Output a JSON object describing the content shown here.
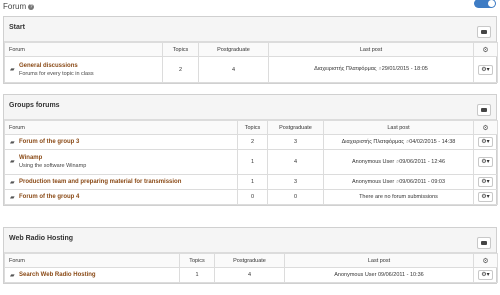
{
  "header": {
    "title": "Forum",
    "help_icon": "question-circle-icon"
  },
  "columns": {
    "forum": "Forum",
    "topics": "Topics",
    "postgraduate": "Postgraduate",
    "last_post": "Last post"
  },
  "categories": [
    {
      "title": "Start",
      "rows": [
        {
          "name": "General discussions",
          "description": "Forums for every topic in class",
          "topics": "2",
          "postgraduate": "4",
          "last_post_author": "Διαχειριστής Πλατφόρμας",
          "last_post_date": "29/01/2015 - 18:05"
        }
      ]
    },
    {
      "title": "Groups forums",
      "rows": [
        {
          "name": "Forum of the group 3",
          "description": "",
          "topics": "2",
          "postgraduate": "3",
          "last_post_author": "Διαχειριστής Πλατφόρμας",
          "last_post_date": "04/02/2015 - 14:38"
        },
        {
          "name": "Winamp",
          "description": "Using the software Winamp",
          "topics": "1",
          "postgraduate": "4",
          "last_post_author": "Anonymous User",
          "last_post_date": "09/06/2011 - 12:46"
        },
        {
          "name": "Production team and preparing material for transmission",
          "description": "",
          "topics": "1",
          "postgraduate": "3",
          "last_post_author": "Anonymous User",
          "last_post_date": "09/06/2011 - 09:03"
        },
        {
          "name": "Forum of the group 4",
          "description": "",
          "topics": "0",
          "postgraduate": "0",
          "last_post_text": "There are no forum submissions"
        }
      ]
    },
    {
      "title": "Web Radio Hosting",
      "rows": [
        {
          "name": "Search Web Radio Hosting",
          "description": "",
          "topics": "1",
          "postgraduate": "4",
          "last_post_author": "Anonymous User",
          "last_post_date": "09/06/2011 - 10:36"
        }
      ]
    }
  ],
  "icons": {
    "row": "chat-icon",
    "row_action": "gear-icon",
    "head_action": "gears-icon",
    "panel_action": "envelope-icon"
  }
}
